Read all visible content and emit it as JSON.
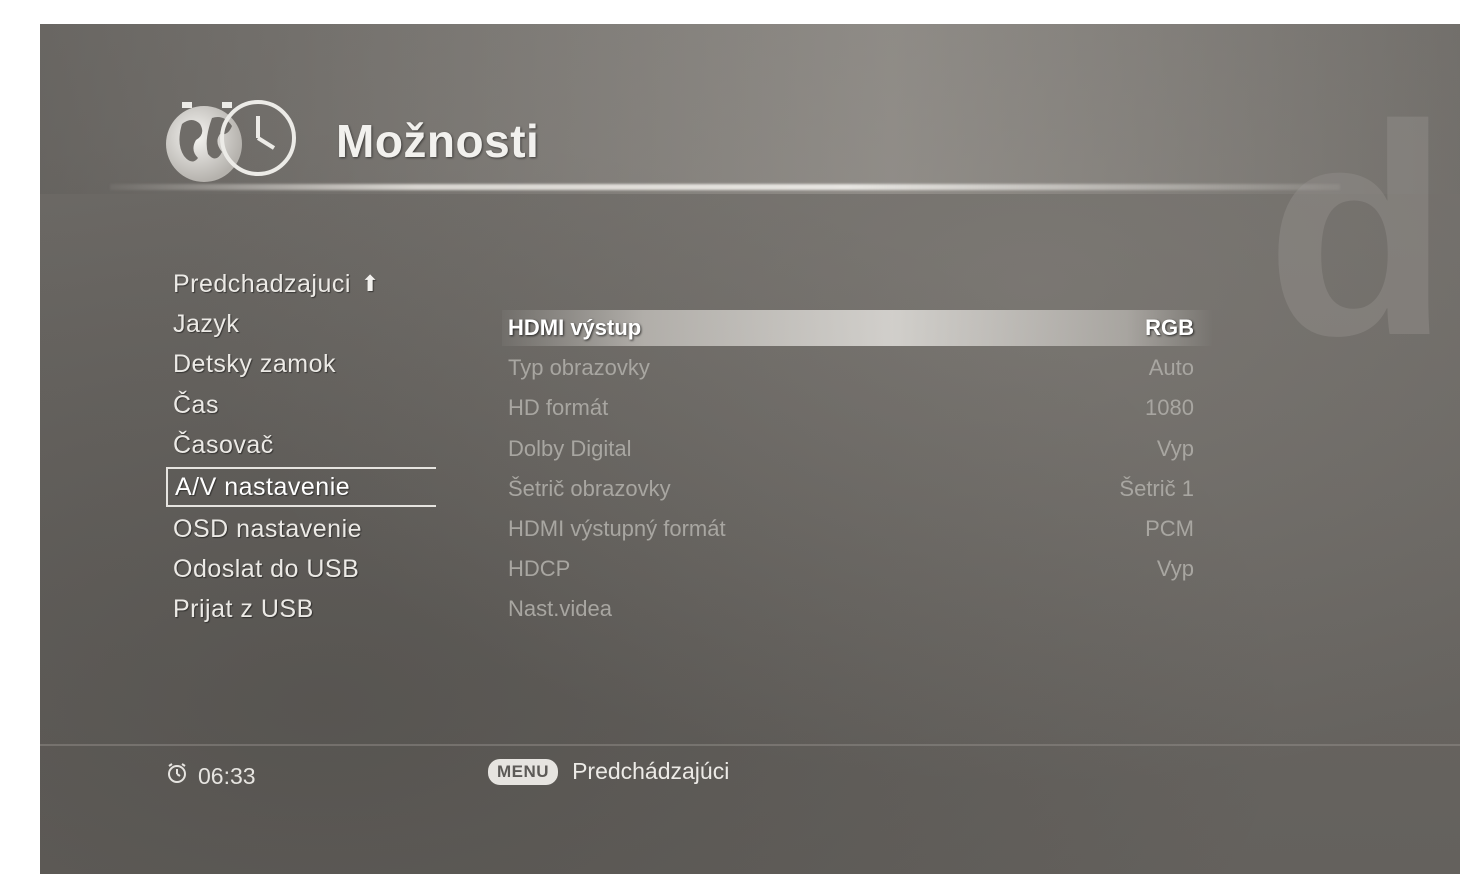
{
  "header": {
    "title": "Možnosti",
    "logo_icon": "globe-clock-icon",
    "brand_watermark": "d"
  },
  "left_menu": {
    "items": [
      {
        "label": "Predchadzajuci",
        "icon": "up-arrow-icon"
      },
      {
        "label": "Jazyk"
      },
      {
        "label": "Detsky zamok"
      },
      {
        "label": "Čas"
      },
      {
        "label": "Časovač"
      },
      {
        "label": "A/V nastavenie",
        "selected": true
      },
      {
        "label": "OSD nastavenie"
      },
      {
        "label": "Odoslat do USB"
      },
      {
        "label": "Prijat z USB"
      }
    ]
  },
  "settings": {
    "rows": [
      {
        "label": "HDMI výstup",
        "value": "RGB",
        "highlighted": true
      },
      {
        "label": "Typ obrazovky",
        "value": "Auto"
      },
      {
        "label": "HD formát",
        "value": "1080"
      },
      {
        "label": "Dolby Digital",
        "value": "Vyp"
      },
      {
        "label": "Šetrič obrazovky",
        "value": "Šetrič 1"
      },
      {
        "label": "HDMI výstupný formát",
        "value": "PCM"
      },
      {
        "label": "HDCP",
        "value": "Vyp"
      },
      {
        "label": "Nast.videa",
        "value": ""
      }
    ]
  },
  "footer": {
    "clock_icon": "alarm-clock-icon",
    "time": "06:33",
    "menu_key": "MENU",
    "menu_hint": "Predchádzajúci"
  },
  "colors": {
    "background": "#6a6763",
    "text_primary": "#eceae6",
    "text_dim": "#a8a6a1",
    "highlight": "#e1dfdb"
  }
}
